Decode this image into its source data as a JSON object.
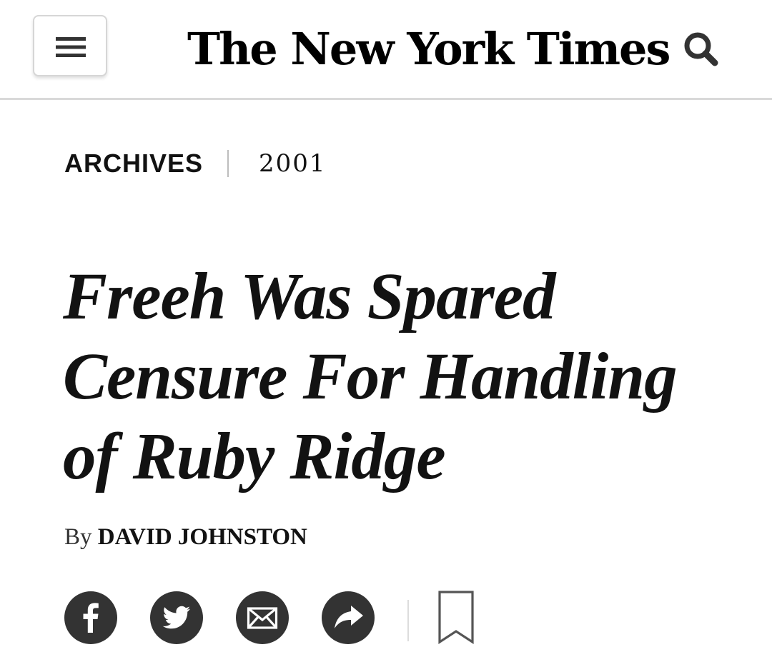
{
  "header": {
    "menu_icon": "hamburger-menu-icon",
    "masthead": "The New York Times",
    "search_icon": "search-icon"
  },
  "kicker": {
    "section": "ARCHIVES",
    "year": "2001"
  },
  "article": {
    "headline_lines": [
      "Freeh Was Spared",
      "Censure For Handling",
      "of Ruby Ridge"
    ],
    "byline_prefix": "By",
    "author": "DAVID JOHNSTON"
  },
  "share_tools": [
    {
      "name": "facebook",
      "icon": "facebook-icon"
    },
    {
      "name": "twitter",
      "icon": "twitter-icon"
    },
    {
      "name": "email",
      "icon": "email-icon"
    },
    {
      "name": "share",
      "icon": "share-arrow-icon"
    },
    {
      "name": "save",
      "icon": "bookmark-icon"
    }
  ],
  "colors": {
    "text": "#121212",
    "share_circle": "#333333",
    "header_rule": "#d9d9d9"
  }
}
